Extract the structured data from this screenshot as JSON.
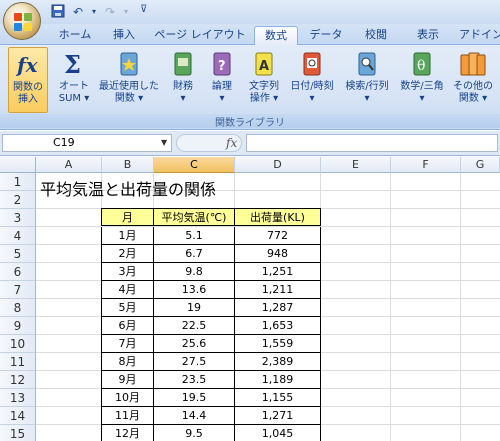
{
  "quick_access": {
    "save_icon": "save-icon",
    "undo_icon": "undo-icon",
    "redo_icon": "redo-icon"
  },
  "tabs": [
    {
      "label": "ホーム",
      "active": false
    },
    {
      "label": "挿入",
      "active": false
    },
    {
      "label": "ページ レイアウト",
      "active": false
    },
    {
      "label": "数式",
      "active": true
    },
    {
      "label": "データ",
      "active": false
    },
    {
      "label": "校閲",
      "active": false
    },
    {
      "label": "表示",
      "active": false
    },
    {
      "label": "アドイン",
      "active": false
    }
  ],
  "ribbon": {
    "buttons": [
      {
        "label1": "関数の",
        "label2": "挿入",
        "icon": "insert-function-icon"
      },
      {
        "label1": "オート",
        "label2": "SUM ▾",
        "icon": "autosum-icon"
      },
      {
        "label1": "最近使用した",
        "label2": "関数 ▾",
        "icon": "recent-functions-icon"
      },
      {
        "label1": "財務",
        "label2": "▾",
        "icon": "financial-icon"
      },
      {
        "label1": "論理",
        "label2": "▾",
        "icon": "logical-icon"
      },
      {
        "label1": "文字列",
        "label2": "操作 ▾",
        "icon": "text-icon"
      },
      {
        "label1": "日付/時刻",
        "label2": "▾",
        "icon": "date-time-icon"
      },
      {
        "label1": "検索/行列",
        "label2": "▾",
        "icon": "lookup-icon"
      },
      {
        "label1": "数学/三角",
        "label2": "▾",
        "icon": "math-trig-icon"
      },
      {
        "label1": "その他の",
        "label2": "関数 ▾",
        "icon": "more-functions-icon"
      }
    ],
    "group_label": "関数ライブラリ"
  },
  "formula_bar": {
    "name_box": "C19",
    "fx": "fx",
    "formula": ""
  },
  "columns": [
    "A",
    "B",
    "C",
    "D",
    "E",
    "F",
    "G"
  ],
  "selected_column": "C",
  "rows": [
    "1",
    "2",
    "3",
    "4",
    "5",
    "6",
    "7",
    "8",
    "9",
    "10",
    "11",
    "12",
    "13",
    "14",
    "15"
  ],
  "sheet_title": "平均気温と出荷量の関係",
  "table": {
    "headers": [
      "月",
      "平均気温(℃)",
      "出荷量(KL)"
    ],
    "rows": [
      [
        "1月",
        "5.1",
        "772"
      ],
      [
        "2月",
        "6.7",
        "948"
      ],
      [
        "3月",
        "9.8",
        "1,251"
      ],
      [
        "4月",
        "13.6",
        "1,211"
      ],
      [
        "5月",
        "19",
        "1,287"
      ],
      [
        "6月",
        "22.5",
        "1,653"
      ],
      [
        "7月",
        "25.6",
        "1,559"
      ],
      [
        "8月",
        "27.5",
        "2,389"
      ],
      [
        "9月",
        "23.5",
        "1,189"
      ],
      [
        "10月",
        "19.5",
        "1,155"
      ],
      [
        "11月",
        "14.4",
        "1,271"
      ],
      [
        "12月",
        "9.5",
        "1,045"
      ]
    ]
  },
  "colors": {
    "header_fill": "#ffff99",
    "selected_column": "#f1c15f",
    "ribbon_bg": "#d7e4f5"
  }
}
